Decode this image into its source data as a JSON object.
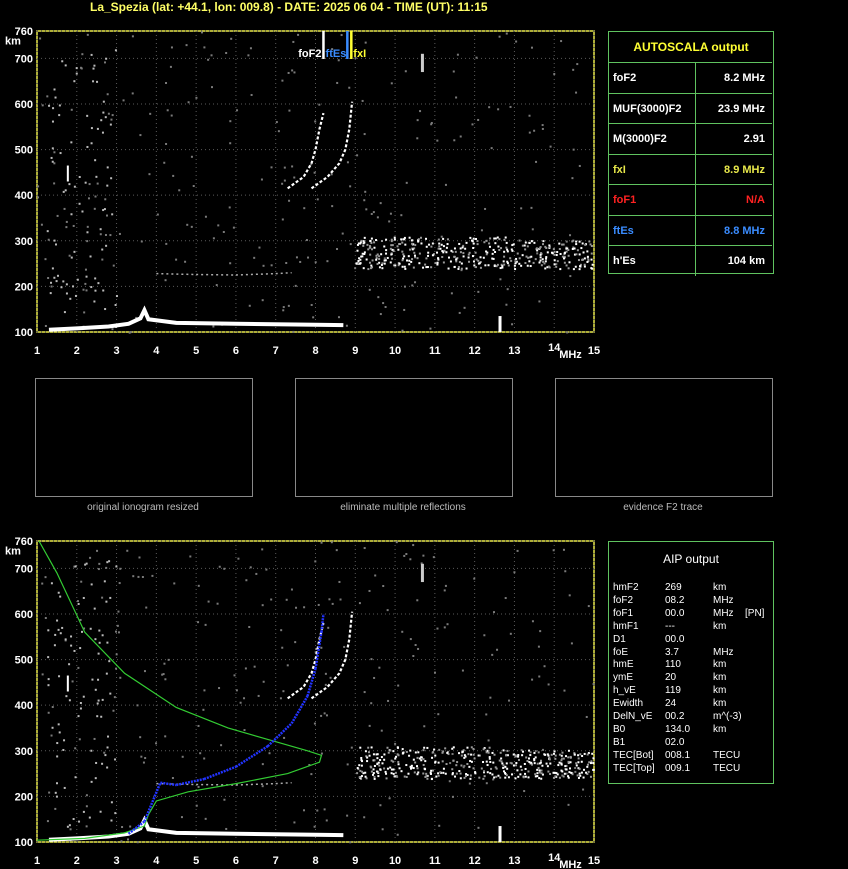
{
  "header": {
    "title": "La_Spezia (lat: +44.1, lon: 009.8) - DATE: 2025 06 04 - TIME (UT): 11:15"
  },
  "ionogram_top": {
    "ylabel": "km",
    "yticks": [
      100,
      200,
      300,
      400,
      500,
      600,
      700,
      760
    ],
    "xticks": [
      1,
      2,
      3,
      4,
      5,
      6,
      7,
      8,
      9,
      10,
      11,
      12,
      13,
      14,
      15
    ],
    "xunit": "MHz",
    "markers": [
      {
        "label": "foF2",
        "value": 8.2,
        "color": "#ffffff"
      },
      {
        "label": "ftEs",
        "value": 8.8,
        "color": "#3a8cff"
      },
      {
        "label": "fxI",
        "value": 8.9,
        "color": "#ffff33"
      }
    ]
  },
  "autoscala": {
    "title": "AUTOSCALA output",
    "rows": [
      {
        "label": "foF2",
        "value": "8.2 MHz",
        "color": "#ffffff"
      },
      {
        "label": "MUF(3000)F2",
        "value": "23.9 MHz",
        "color": "#ffffff"
      },
      {
        "label": "M(3000)F2",
        "value": "2.91",
        "color": "#ffffff"
      },
      {
        "label": "fxI",
        "value": "8.9 MHz",
        "color": "#e8e84a"
      },
      {
        "label": "foF1",
        "value": "N/A",
        "color": "#ff2222"
      },
      {
        "label": "ftEs",
        "value": "8.8 MHz",
        "color": "#3a8cff"
      },
      {
        "label": "h'Es",
        "value": "104     km",
        "color": "#ffffff"
      }
    ]
  },
  "thumbnails": [
    {
      "caption": "original ionogram resized"
    },
    {
      "caption": "eliminate multiple reflections"
    },
    {
      "caption": "evidence F2 trace"
    }
  ],
  "aip": {
    "title": "AIP output",
    "rows": [
      [
        "hmF2",
        "269",
        "km",
        ""
      ],
      [
        "foF2",
        "08.2",
        "MHz",
        ""
      ],
      [
        "foF1",
        "00.0",
        "MHz",
        "[PN]"
      ],
      [
        "hmF1",
        "---",
        "km",
        ""
      ],
      [
        "D1",
        "00.0",
        "",
        ""
      ],
      [
        "foE",
        "3.7",
        "MHz",
        ""
      ],
      [
        "hmE",
        "110",
        "km",
        ""
      ],
      [
        "ymE",
        "20",
        "km",
        ""
      ],
      [
        "h_vE",
        "119",
        "km",
        ""
      ],
      [
        "Ewidth",
        "24",
        "km",
        ""
      ],
      [
        "DelN_vE",
        "00.2",
        "m^(-3)",
        ""
      ],
      [
        "B0",
        "134.0",
        "km",
        ""
      ],
      [
        "B1",
        "02.0",
        "",
        ""
      ],
      [
        "TEC[Bot]",
        "008.1",
        "TECU",
        ""
      ],
      [
        "TEC[Top]",
        "009.1",
        "TECU",
        ""
      ]
    ]
  },
  "chart_data": {
    "type": "scatter",
    "xlim": [
      1,
      15
    ],
    "ylim": [
      100,
      760
    ],
    "xlabel": "MHz",
    "ylabel": "km",
    "traces": {
      "E_layer": [
        [
          1.3,
          105
        ],
        [
          2,
          108
        ],
        [
          2.8,
          112
        ],
        [
          3.3,
          118
        ],
        [
          3.6,
          130
        ],
        [
          3.7,
          148
        ],
        [
          3.8,
          128
        ],
        [
          4.5,
          120
        ],
        [
          6,
          118
        ],
        [
          8,
          116
        ],
        [
          8.7,
          115
        ]
      ],
      "F2_o": [
        [
          7.3,
          415
        ],
        [
          7.7,
          440
        ],
        [
          7.9,
          470
        ],
        [
          8.0,
          500
        ],
        [
          8.1,
          545
        ],
        [
          8.2,
          580
        ]
      ],
      "F2_x": [
        [
          7.9,
          415
        ],
        [
          8.3,
          440
        ],
        [
          8.6,
          470
        ],
        [
          8.75,
          500
        ],
        [
          8.85,
          545
        ],
        [
          8.92,
          605
        ]
      ],
      "F_spread_band": {
        "x": [
          9,
          15
        ],
        "y": [
          240,
          310
        ]
      },
      "weak_F": [
        [
          4.0,
          228
        ],
        [
          5,
          226
        ],
        [
          6,
          225
        ],
        [
          7,
          228
        ],
        [
          7.4,
          230
        ]
      ]
    },
    "aip_profile": [
      [
        3.3,
        118
      ],
      [
        3.7,
        145
      ],
      [
        4.1,
        230
      ],
      [
        4.5,
        225
      ],
      [
        5.2,
        238
      ],
      [
        6,
        265
      ],
      [
        6.8,
        310
      ],
      [
        7.4,
        360
      ],
      [
        7.8,
        420
      ],
      [
        8.0,
        480
      ],
      [
        8.15,
        560
      ],
      [
        8.2,
        600
      ]
    ],
    "aip_green": [
      [
        1.05,
        760
      ],
      [
        1.5,
        690
      ],
      [
        2.2,
        560
      ],
      [
        3.2,
        470
      ],
      [
        4.5,
        395
      ],
      [
        5.8,
        350
      ],
      [
        7.0,
        320
      ],
      [
        7.8,
        300
      ],
      [
        8.15,
        290
      ],
      [
        8.1,
        275
      ],
      [
        7.3,
        250
      ],
      [
        6.0,
        228
      ],
      [
        4.8,
        210
      ],
      [
        4.0,
        190
      ],
      [
        3.8,
        160
      ],
      [
        3.7,
        135
      ],
      [
        3.2,
        120
      ],
      [
        2.2,
        108
      ],
      [
        1.0,
        104
      ]
    ]
  }
}
